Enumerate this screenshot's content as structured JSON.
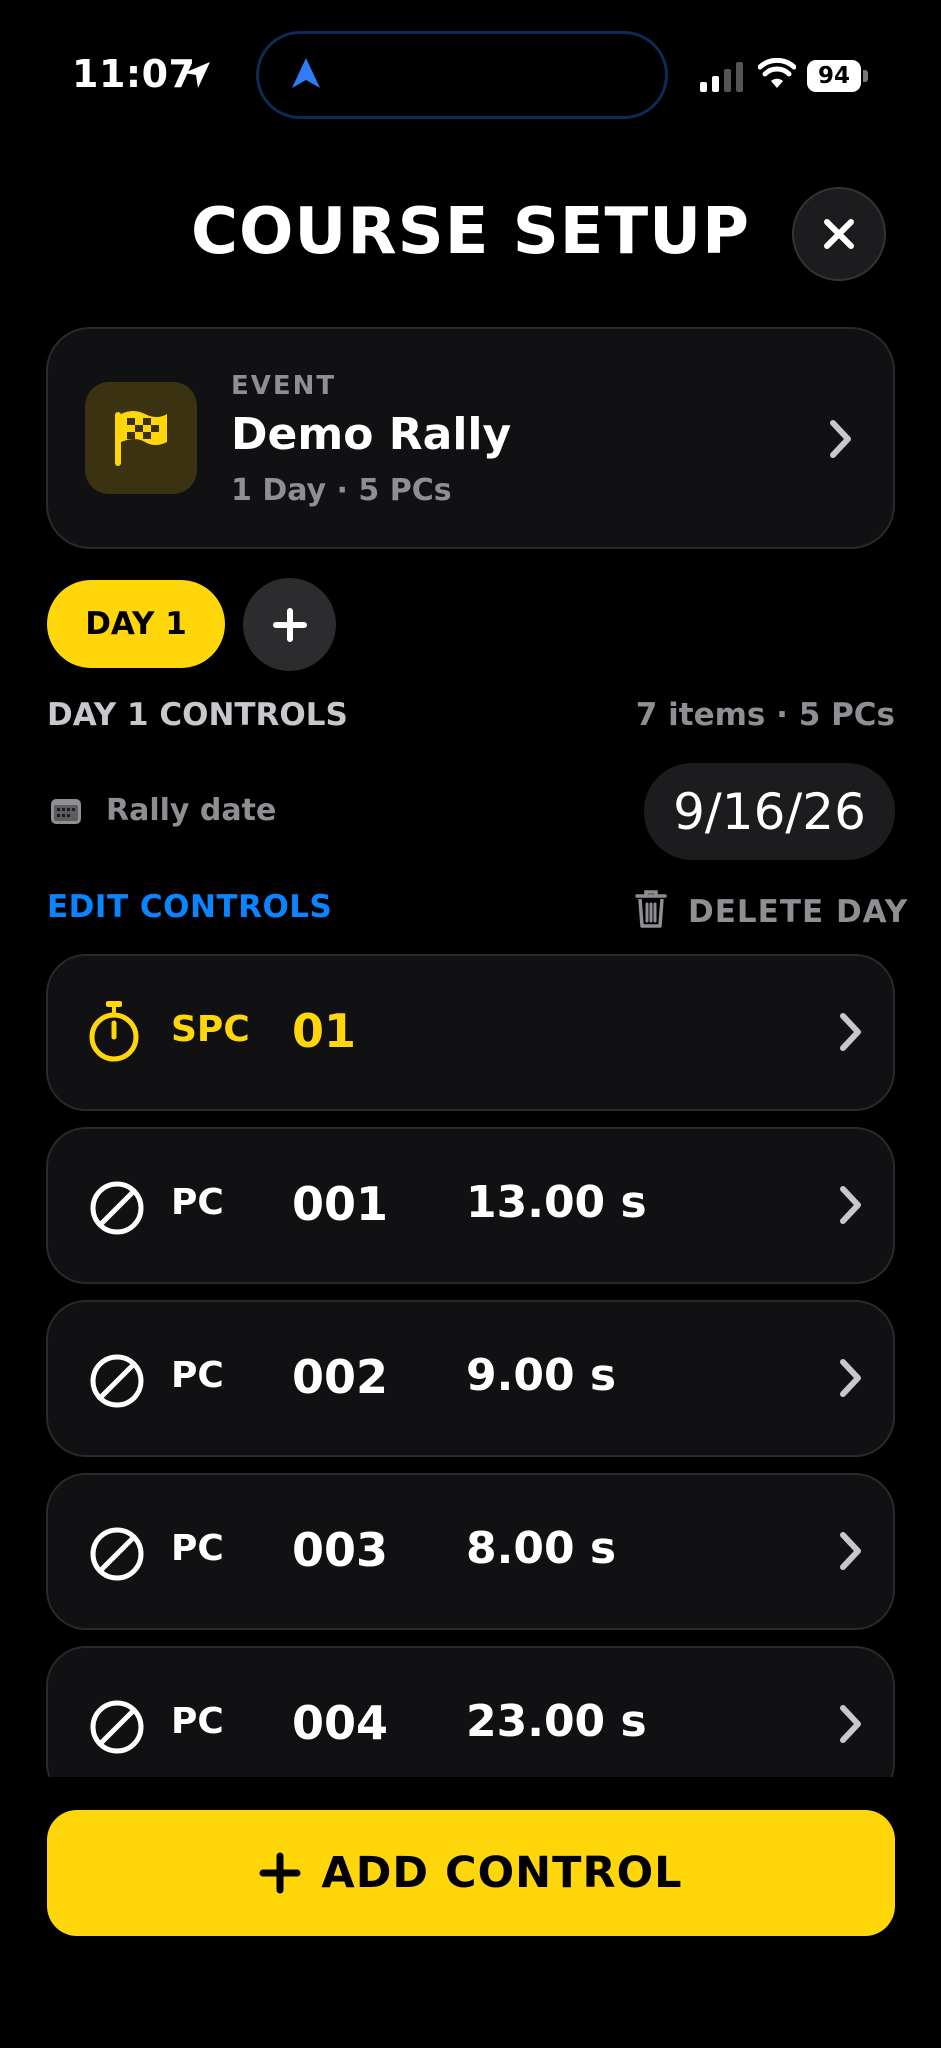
{
  "status_bar": {
    "time": "11:07",
    "battery": "94"
  },
  "header": {
    "title": "COURSE SETUP"
  },
  "event": {
    "label": "EVENT",
    "name": "Demo Rally",
    "subtitle": "1 Day · 5 PCs"
  },
  "days": {
    "tabs": [
      {
        "label": "DAY 1",
        "selected": true
      }
    ]
  },
  "section": {
    "title": "DAY 1 CONTROLS",
    "meta": "7 items · 5 PCs",
    "date_label": "Rally date",
    "date_value": "9/16/26",
    "edit_label": "EDIT CONTROLS",
    "delete_label": "DELETE DAY"
  },
  "controls": [
    {
      "type": "SPC",
      "number": "01",
      "time": "",
      "icon": "stopwatch-icon",
      "accent": "#ffd60a"
    },
    {
      "type": "PC",
      "number": "001",
      "time": "13.00 s",
      "icon": "no-entry-icon"
    },
    {
      "type": "PC",
      "number": "002",
      "time": "9.00 s",
      "icon": "no-entry-icon"
    },
    {
      "type": "PC",
      "number": "003",
      "time": "8.00 s",
      "icon": "no-entry-icon"
    },
    {
      "type": "PC",
      "number": "004",
      "time": "23.00 s",
      "icon": "no-entry-icon"
    }
  ],
  "footer": {
    "add_label": "ADD CONTROL"
  },
  "colors": {
    "accent": "#ffd60a",
    "link": "#0a84ff",
    "background": "#000000"
  }
}
